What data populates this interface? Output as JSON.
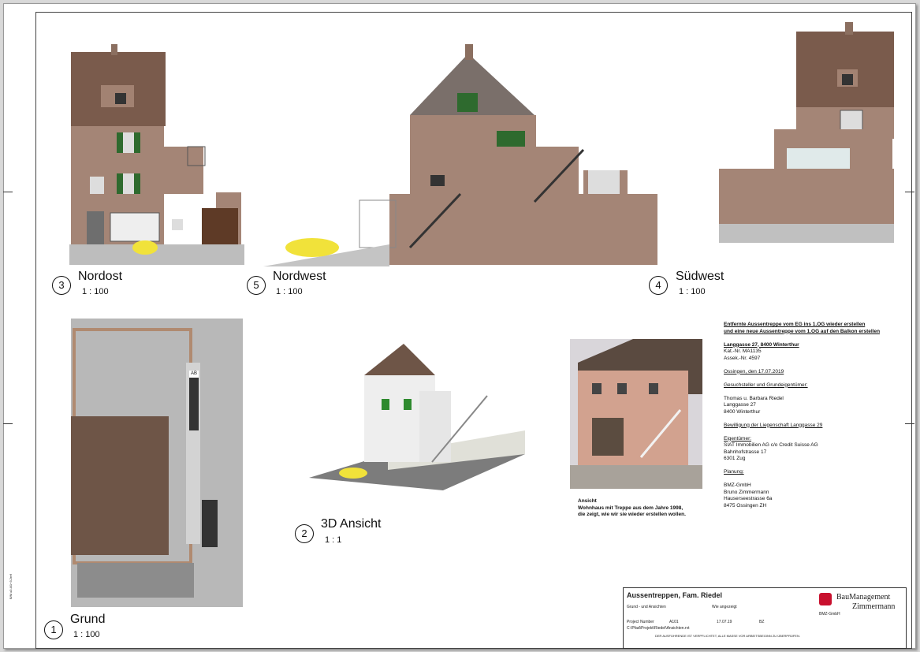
{
  "views": [
    {
      "num": "3",
      "title": "Nordost",
      "scale": "1 : 100"
    },
    {
      "num": "5",
      "title": "Nordwest",
      "scale": "1 : 100"
    },
    {
      "num": "4",
      "title": "Südwest",
      "scale": "1 : 100"
    },
    {
      "num": "1",
      "title": "Grund",
      "scale": "1 : 100"
    },
    {
      "num": "2",
      "title": "3D Ansicht",
      "scale": "1 : 1"
    }
  ],
  "plan_label": "AB",
  "photo_caption": {
    "line1": "Ansicht",
    "line2": "Wohnhaus mit Treppe aus dem Jahre 1998,",
    "line3": "die zeigt, wie wir sie wieder erstellen wollen."
  },
  "info": {
    "heading1": "Entfernte Aussentreppe vom EG ins 1.OG wieder erstellen",
    "heading2": "und eine neue Aussentreppe vom 1.OG auf den Balkon erstellen",
    "address": "Langgasse 27, 8400 Winterthur",
    "kat": "Kat.-Nr. MA1135",
    "assek": "Assek.-Nr. 4597",
    "date": "Ossingen, den 17.07.2019",
    "applicant_h": "Gesuchsteller und Grundeigentümer:",
    "applicant1": "Thomas u. Barbara Riedel",
    "applicant2": "Langgasse 27",
    "applicant3": "8400 Winterthur",
    "permit": "Bewilligung der Liegenschaft Langgasse 29",
    "owner_h": "Eigentümer:",
    "owner1": "SIAT Immobilien AG c/o Credit Suisse AG",
    "owner2": "Bahnhofstrasse 17",
    "owner3": "6301 Zug",
    "plan_h": "Planung:",
    "plan1": "BMZ-GmbH",
    "plan2": "Bruno Zimmermann",
    "plan3": "Hauserseestrasse 6a",
    "plan4": "8475 Ossingen ZH"
  },
  "title_block": {
    "project": "Aussentreppen, Fam. Riedel",
    "sheet_desc": "Grund - und Ansichten",
    "scale_note": "Wie angezeigt",
    "company1": "BauManagement",
    "company2": "Zimmermann",
    "company_sub": "BMZ-GmbH",
    "proj_no_label": "Project Number",
    "sheet_no": "A101",
    "date": "17.07.19",
    "rev": "BZ",
    "path": "C:\\Pfad\\Projekt\\Riedel\\Ansichten.rvt",
    "disclaimer": "DER AUSFÜHRENDE IST VERPFLICHTET, ALLE MASSE VOR ARBEITSBEGINN ZU ÜBERPRÜFEN."
  },
  "side_stamp": "B/M x3.4/1+3.2ref"
}
